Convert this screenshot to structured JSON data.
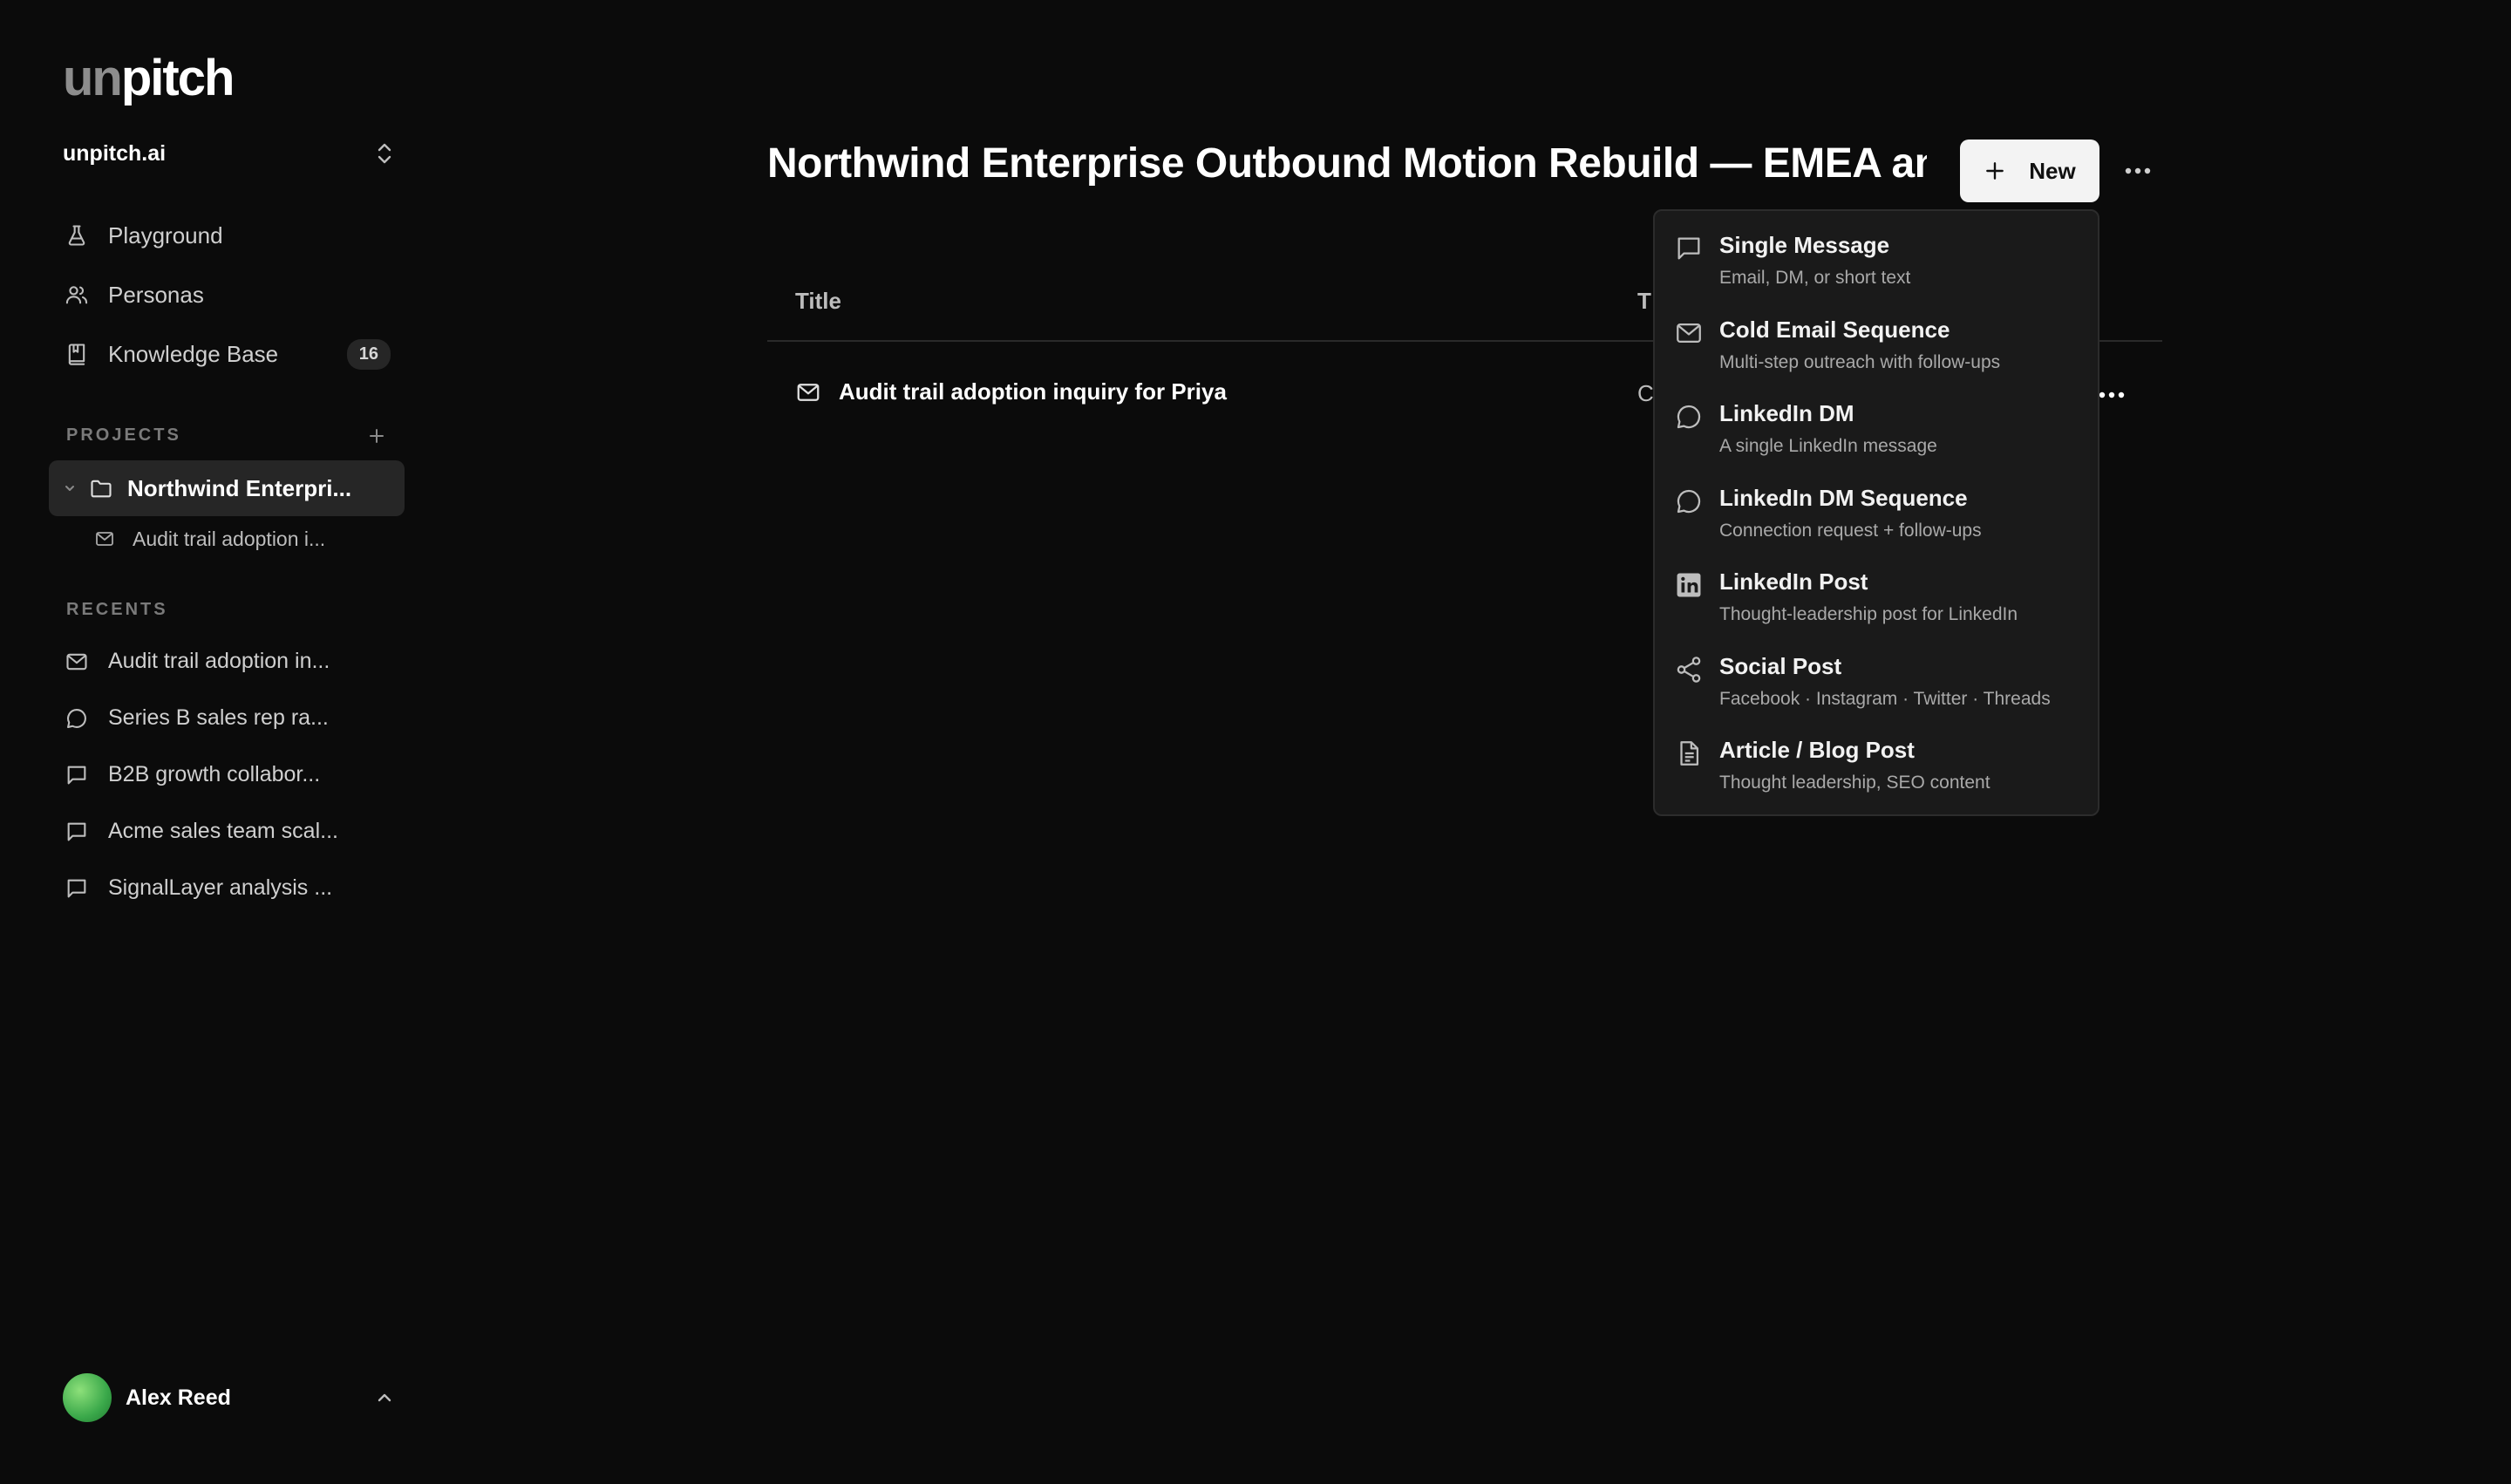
{
  "sidebar": {
    "logo": {
      "part1": "un",
      "part2": "pitch"
    },
    "workspace": "unpitch.ai",
    "nav": [
      {
        "label": "Playground",
        "icon": "flask-icon"
      },
      {
        "label": "Personas",
        "icon": "users-icon"
      },
      {
        "label": "Knowledge Base",
        "icon": "book-icon",
        "badge": "16"
      }
    ],
    "projects_label": "PROJECTS",
    "project": {
      "label": "Northwind Enterpri...",
      "icon": "folder-icon"
    },
    "project_child": {
      "label": "Audit trail adoption i...",
      "icon": "mail-icon"
    },
    "recents_label": "RECENTS",
    "recents": [
      {
        "label": "Audit trail adoption in...",
        "icon": "mail-icon"
      },
      {
        "label": "Series B sales rep ra...",
        "icon": "chat-bubble-icon"
      },
      {
        "label": "B2B growth collabor...",
        "icon": "message-square-icon"
      },
      {
        "label": "Acme sales team scal...",
        "icon": "message-square-icon"
      },
      {
        "label": "SignalLayer analysis ...",
        "icon": "message-square-icon"
      }
    ],
    "user": {
      "name": "Alex Reed"
    }
  },
  "main": {
    "title": "Northwind Enterprise Outbound Motion Rebuild — EMEA an...",
    "new_label": "New",
    "table": {
      "columns": [
        "Title",
        "T"
      ],
      "rows": [
        {
          "title": "Audit trail adoption inquiry for Priya",
          "type": "C"
        }
      ]
    }
  },
  "menu": {
    "items": [
      {
        "title": "Single Message",
        "desc": "Email, DM, or short text",
        "icon": "message-square-icon"
      },
      {
        "title": "Cold Email Sequence",
        "desc": "Multi-step outreach with follow-ups",
        "icon": "mail-icon"
      },
      {
        "title": "LinkedIn DM",
        "desc": "A single LinkedIn message",
        "icon": "chat-bubble-icon"
      },
      {
        "title": "LinkedIn DM Sequence",
        "desc": "Connection request + follow-ups",
        "icon": "chat-bubble-icon"
      },
      {
        "title": "LinkedIn Post",
        "desc": "Thought-leadership post for LinkedIn",
        "icon": "linkedin-icon"
      },
      {
        "title": "Social Post",
        "desc": "Facebook · Instagram · Twitter · Threads",
        "icon": "share-icon"
      },
      {
        "title": "Article / Blog Post",
        "desc": "Thought leadership, SEO content",
        "icon": "document-icon"
      }
    ]
  },
  "colors": {
    "background": "#0b0b0b",
    "menu_bg": "#1a1a1a",
    "selected_bg": "#262626",
    "button_bg": "#f3f3f3"
  }
}
